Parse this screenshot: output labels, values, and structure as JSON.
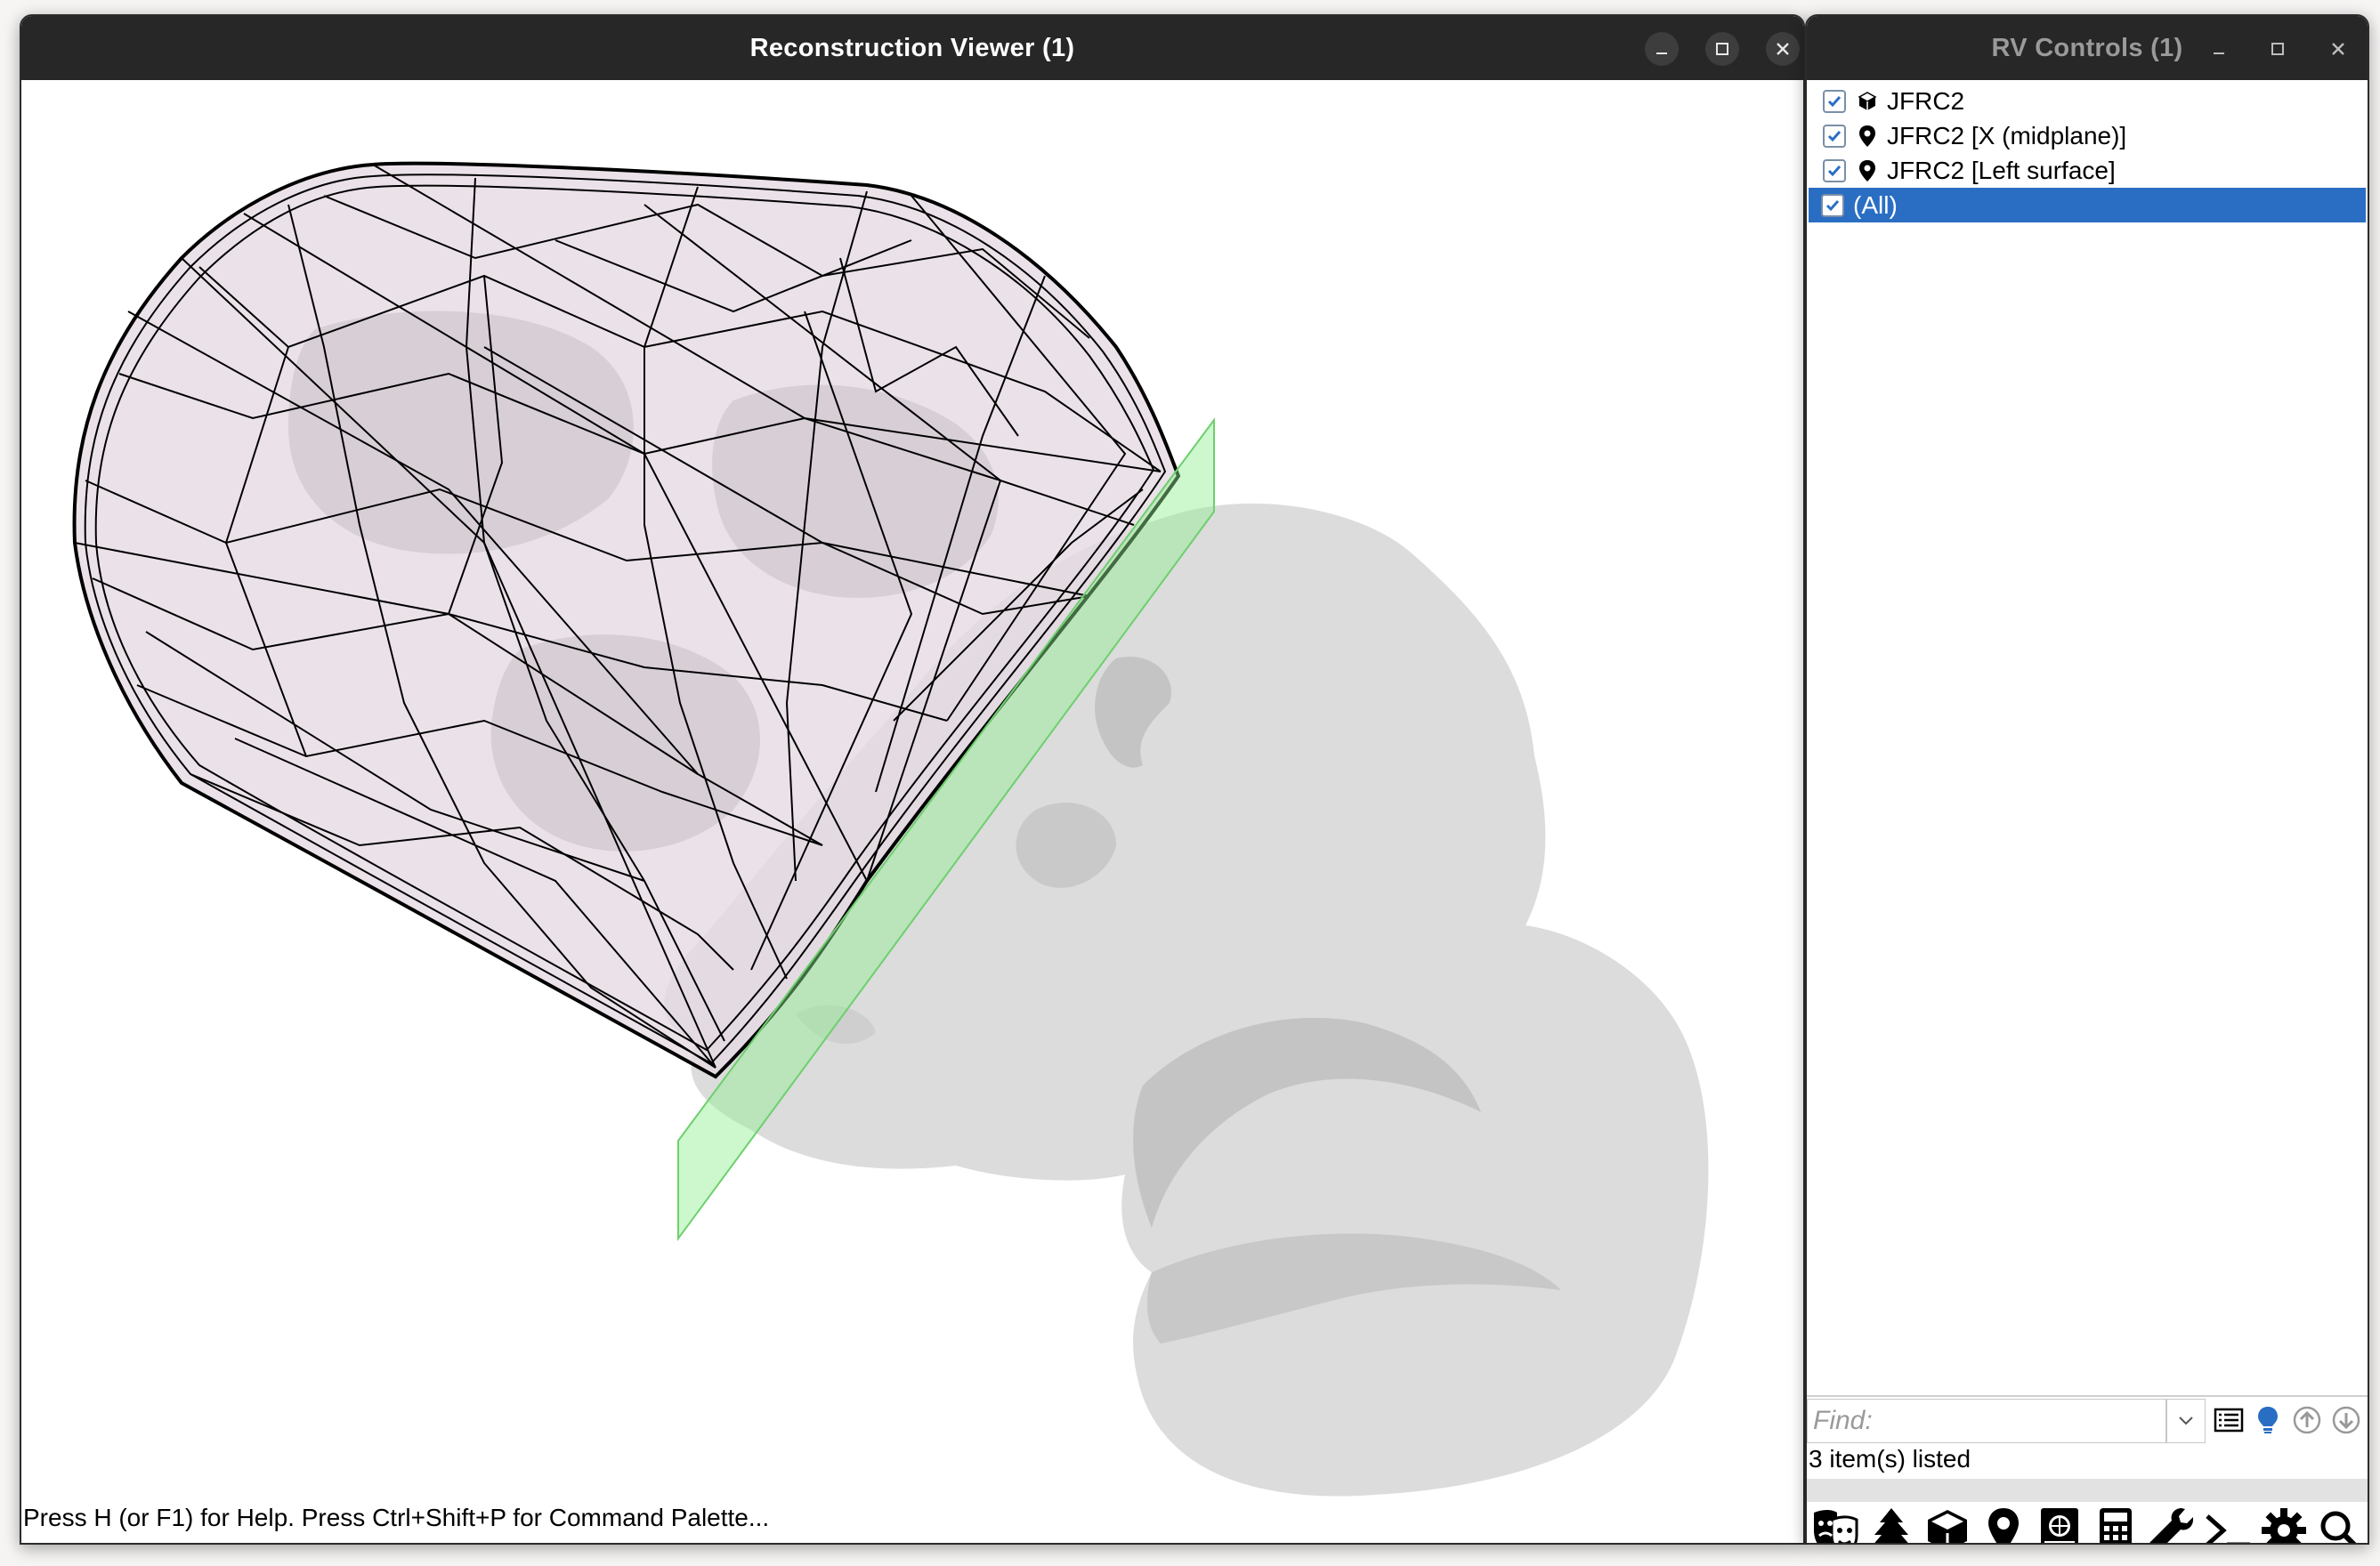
{
  "viewer": {
    "title": "Reconstruction Viewer (1)",
    "status_text": "Press H (or F1) for Help. Press Ctrl+Shift+P for Command Palette..."
  },
  "controls": {
    "title": "RV Controls (1)",
    "tree": [
      {
        "label": "JFRC2",
        "icon": "cube-icon",
        "checked": true
      },
      {
        "label": "JFRC2 [X (midplane)]",
        "icon": "map-pin-icon",
        "checked": true
      },
      {
        "label": "JFRC2 [Left surface]",
        "icon": "map-pin-icon",
        "checked": true
      },
      {
        "label": "(All)",
        "icon": "",
        "checked": true,
        "selected": true
      }
    ],
    "find_placeholder": "Find:",
    "items_count": "3 item(s) listed",
    "toolbar_icons": [
      "masks-icon",
      "tree-icon",
      "cube-icon",
      "map-pin-icon",
      "atlas-icon",
      "calculator-icon",
      "wrench-icon",
      "terminal-icon",
      "gear-icon",
      "search-icon"
    ]
  },
  "colors": {
    "titlebar": "#272727",
    "selection": "#2a6ec4",
    "plane": "#90ee90",
    "mesh": "#d9d9d9",
    "hull_fill": "#e9dfe6"
  }
}
